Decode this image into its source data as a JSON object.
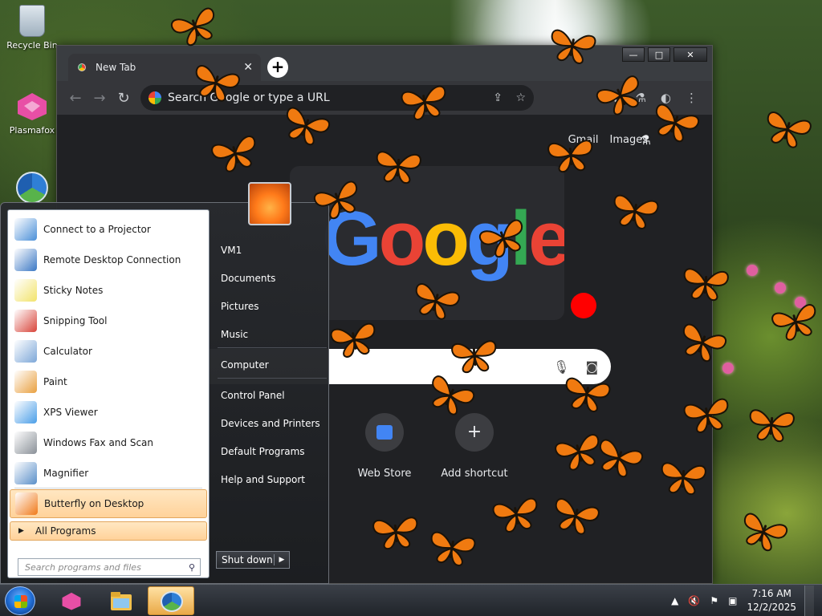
{
  "desktop": {
    "icons": [
      {
        "label": "Recycle Bin",
        "icon": "recycle-bin-icon"
      },
      {
        "label": "Plasmafox",
        "icon": "plasmafox-icon"
      },
      {
        "label": "",
        "icon": "chrome-icon"
      }
    ]
  },
  "browser": {
    "tab_title": "New Tab",
    "tab_close": "✕",
    "new_tab": "+",
    "window_controls": {
      "minimize": "—",
      "maximize": "□",
      "close": "✕"
    },
    "nav": {
      "back": "←",
      "forward": "→",
      "reload": "↻"
    },
    "omnibox_placeholder": "Search Google or type a URL",
    "toolbar_icons": [
      "share-icon",
      "star-icon",
      "extensions-icon",
      "labs-icon",
      "menu-icon"
    ],
    "ntp": {
      "links": [
        "Gmail",
        "Images"
      ],
      "doodle_text": "Google",
      "shortcuts": [
        {
          "label": "Web Store",
          "icon": "web-store-icon"
        },
        {
          "label": "Add shortcut",
          "icon": "plus-icon"
        }
      ]
    }
  },
  "start_menu": {
    "programs": [
      {
        "label": "Connect to a Projector",
        "color": "#4a8fd8"
      },
      {
        "label": "Remote Desktop Connection",
        "color": "#3b78c4"
      },
      {
        "label": "Sticky Notes",
        "color": "#f2e36b"
      },
      {
        "label": "Snipping Tool",
        "color": "#d8443a"
      },
      {
        "label": "Calculator",
        "color": "#7da7d8"
      },
      {
        "label": "Paint",
        "color": "#e9a040"
      },
      {
        "label": "XPS Viewer",
        "color": "#4a9ee8"
      },
      {
        "label": "Windows Fax and Scan",
        "color": "#8a9098"
      },
      {
        "label": "Magnifier",
        "color": "#5a8fc8"
      },
      {
        "label": "Butterfly on Desktop",
        "color": "#f07a1a",
        "highlighted": true
      }
    ],
    "all_programs": "All Programs",
    "search_placeholder": "Search programs and files",
    "places": [
      {
        "label": "VM1",
        "sep_after": false
      },
      {
        "label": "Documents",
        "sep_after": false
      },
      {
        "label": "Pictures",
        "sep_after": false
      },
      {
        "label": "Music",
        "sep_after": true
      },
      {
        "label": "Computer",
        "sep_after": true
      },
      {
        "label": "Control Panel",
        "sep_after": false
      },
      {
        "label": "Devices and Printers",
        "sep_after": false
      },
      {
        "label": "Default Programs",
        "sep_after": false
      },
      {
        "label": "Help and Support",
        "sep_after": false
      }
    ],
    "shutdown_label": "Shut down",
    "shutdown_arrow": "▶"
  },
  "taskbar": {
    "apps": [
      "plasmafox-icon",
      "explorer-icon",
      "chrome-icon"
    ],
    "active_app": "chrome-icon",
    "tray": {
      "icons": [
        "show-hidden-icons",
        "volume-muted-icon",
        "action-center-flag-icon",
        "network-icon"
      ],
      "time": "7:16 AM",
      "date": "12/2/2025"
    }
  },
  "colors": {
    "butterfly_orange": "#f07a10",
    "butterfly_dark": "#1a1208",
    "chrome_bg": "#202124",
    "start_highlight": "#ffd29a"
  }
}
